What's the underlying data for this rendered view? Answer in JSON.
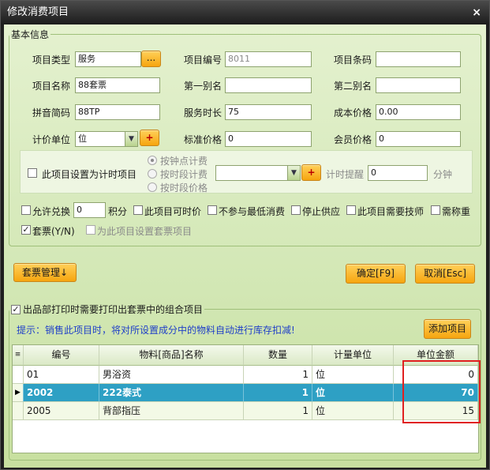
{
  "window": {
    "title": "修改消费项目",
    "close_icon": "close-icon"
  },
  "basic_group": {
    "legend": "基本信息"
  },
  "form": {
    "item_type": {
      "label": "项目类型",
      "value": "服务",
      "browse_label": "..."
    },
    "item_code": {
      "label": "项目编号",
      "value": "8011"
    },
    "item_barcode": {
      "label": "项目条码",
      "value": ""
    },
    "item_name": {
      "label": "项目名称",
      "value": "88套票"
    },
    "alias1": {
      "label": "第一别名",
      "value": ""
    },
    "alias2": {
      "label": "第二别名",
      "value": ""
    },
    "pinyin": {
      "label": "拼音简码",
      "value": "88TP"
    },
    "service_duration": {
      "label": "服务时长",
      "value": "75"
    },
    "cost_price": {
      "label": "成本价格",
      "value": "0.00"
    },
    "unit": {
      "label": "计价单位",
      "value": "位",
      "add_label": "+"
    },
    "standard_price": {
      "label": "标准价格",
      "value": "0"
    },
    "member_price": {
      "label": "会员价格",
      "value": "0"
    }
  },
  "timed": {
    "checkbox_label": "此项目设置为计时项目",
    "radios": [
      "按钟点计费",
      "按时段计费",
      "按时段价格"
    ],
    "period_add_label": "+",
    "reminder_label": "计时提醒",
    "reminder_value": "0",
    "minutes_label": "分钟"
  },
  "options": {
    "allow_exchange": "允许兑换",
    "points_value": "0",
    "points_unit": "积分",
    "timeable": "此项目可时价",
    "no_min_consumption": "不参与最低消费",
    "stop_supply": "停止供应",
    "needs_technician": "此项目需要技师",
    "needs_weighing": "需称重",
    "package": "套票(Y/N)",
    "package_setup": "为此项目设置套票项目",
    "package_checked": true
  },
  "buttons": {
    "package_mgmt": "套票管理↓",
    "ok": "确定[F9]",
    "cancel": "取消[Esc]",
    "add_item": "添加项目"
  },
  "combo_group": {
    "legend": "出品部打印时需要打印出套票中的组合项目",
    "tip": "提示：销售此项目时，将对所设置成分中的物料自动进行库存扣减!"
  },
  "table": {
    "headers": [
      "编号",
      "物料[商品]名称",
      "数量",
      "计量单位",
      "单位金额"
    ],
    "rows": [
      {
        "code": "01",
        "name": "男浴资",
        "qty": "1",
        "unit": "位",
        "amount": "0"
      },
      {
        "code": "2002",
        "name": "222泰式",
        "qty": "1",
        "unit": "位",
        "amount": "70"
      },
      {
        "code": "2005",
        "name": "背部指压",
        "qty": "1",
        "unit": "位",
        "amount": "15"
      }
    ],
    "selected_row": 1
  },
  "colors": {
    "accent_orange": "#f6a50f",
    "selection_blue": "#2ea0c4",
    "highlight_red": "#e02020"
  }
}
